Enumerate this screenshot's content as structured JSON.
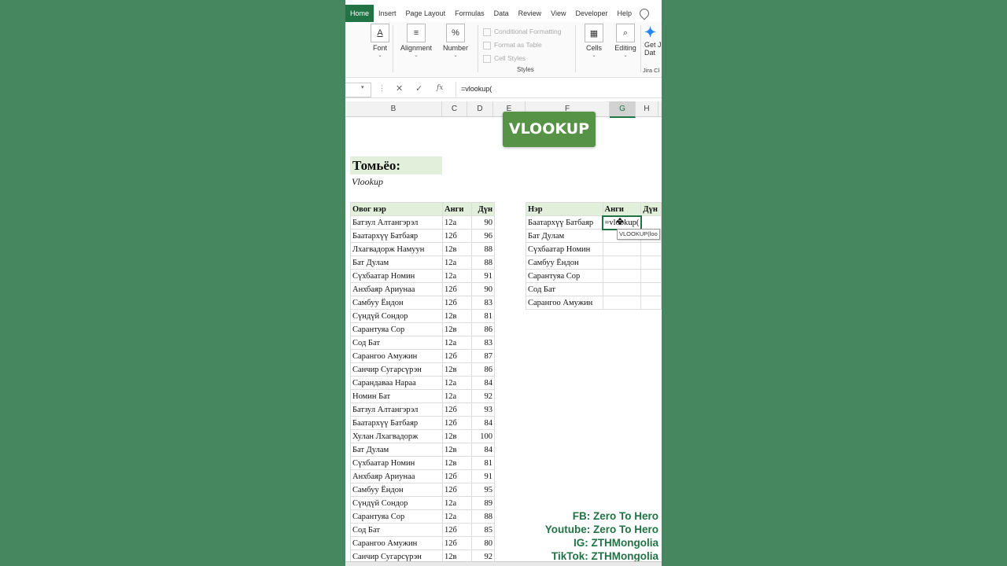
{
  "ribbon": {
    "tabs": [
      "Home",
      "Insert",
      "Page Layout",
      "Formulas",
      "Data",
      "Review",
      "View",
      "Developer",
      "Help"
    ],
    "groups": {
      "font": "Font",
      "alignment": "Alignment",
      "number": "Number",
      "cells": "Cells",
      "editing": "Editing",
      "jira_top": "Get J",
      "jira_mid": "Dat",
      "jira_label": "Jira Cl"
    },
    "styles": {
      "conditional": "Conditional Formatting",
      "format_table": "Format as Table",
      "cell_styles": "Cell Styles",
      "label": "Styles"
    }
  },
  "formula_bar": {
    "fx": "fx",
    "formula": "=vlookup("
  },
  "columns": {
    "b": "B",
    "c": "C",
    "d": "D",
    "e": "E",
    "f": "F",
    "g": "G",
    "h": "H"
  },
  "banner": "VLOOKUP",
  "sheet": {
    "title": "Томьёо:",
    "subtitle": "Vlookup"
  },
  "main_table": {
    "headers": [
      "Овог нэр",
      "Анги",
      "Дүн"
    ],
    "rows": [
      [
        "Батзул Алтангэрэл",
        "12а",
        "90"
      ],
      [
        "Баатархүү Батбаяр",
        "12б",
        "96"
      ],
      [
        "Лхагвадорж Намуун",
        "12в",
        "88"
      ],
      [
        "Бат Дулам",
        "12а",
        "88"
      ],
      [
        "Сүхбаатар Номин",
        "12а",
        "91"
      ],
      [
        "Анхбаяр Ариунаа",
        "12б",
        "90"
      ],
      [
        "Самбуу Ёндон",
        "12б",
        "83"
      ],
      [
        "Сүндүй Сондор",
        "12в",
        "81"
      ],
      [
        "Сарантуяа Сор",
        "12в",
        "86"
      ],
      [
        "Сод Бат",
        "12а",
        "83"
      ],
      [
        "Сарангоо Амужин",
        "12б",
        "87"
      ],
      [
        "Санчир Сугарсүрэн",
        "12в",
        "86"
      ],
      [
        "Сарандаваа Нараа",
        "12а",
        "84"
      ],
      [
        "Номин Бат",
        "12а",
        "92"
      ],
      [
        "Батзул Алтангэрэл",
        "12б",
        "93"
      ],
      [
        "Баатархүү Батбаяр",
        "12б",
        "84"
      ],
      [
        "Хулан Лхагвадорж",
        "12в",
        "100"
      ],
      [
        "Бат Дулам",
        "12в",
        "84"
      ],
      [
        "Сүхбаатар Номин",
        "12в",
        "81"
      ],
      [
        "Анхбаяр Ариунаа",
        "12б",
        "91"
      ],
      [
        "Самбуу Ёндон",
        "12б",
        "95"
      ],
      [
        "Сүндүй Сондор",
        "12а",
        "89"
      ],
      [
        "Сарантуяа Сор",
        "12а",
        "88"
      ],
      [
        "Сод Бат",
        "12б",
        "85"
      ],
      [
        "Сарангоо Амужин",
        "12б",
        "80"
      ],
      [
        "Санчир Сугарсүрэн",
        "12в",
        "92"
      ]
    ]
  },
  "lookup_table": {
    "headers": [
      "Нэр",
      "Анги",
      "Дүн"
    ],
    "rows": [
      [
        "Баатархүү Батбаяр",
        "=vlookup(",
        ""
      ],
      [
        "Бат Дулам",
        "",
        ""
      ],
      [
        "Сүхбаатар Номин",
        "",
        ""
      ],
      [
        "Самбуу Ёндон",
        "",
        ""
      ],
      [
        "Сарантуяа Сор",
        "",
        ""
      ],
      [
        "Сод Бат",
        "",
        ""
      ],
      [
        "Сарангоо Амужин",
        "",
        ""
      ]
    ],
    "tooltip": "VLOOKUP(loo"
  },
  "social": {
    "fb": "FB: Zero To Hero",
    "youtube": "Youtube: Zero To Hero",
    "ig": "IG: ZTHMongolia",
    "tiktok": "TikTok: ZTHMongolia"
  },
  "colors": {
    "background": "#4a8a62",
    "excel_green": "#217346",
    "banner": "#579346",
    "header_fill": "#e2efda"
  }
}
